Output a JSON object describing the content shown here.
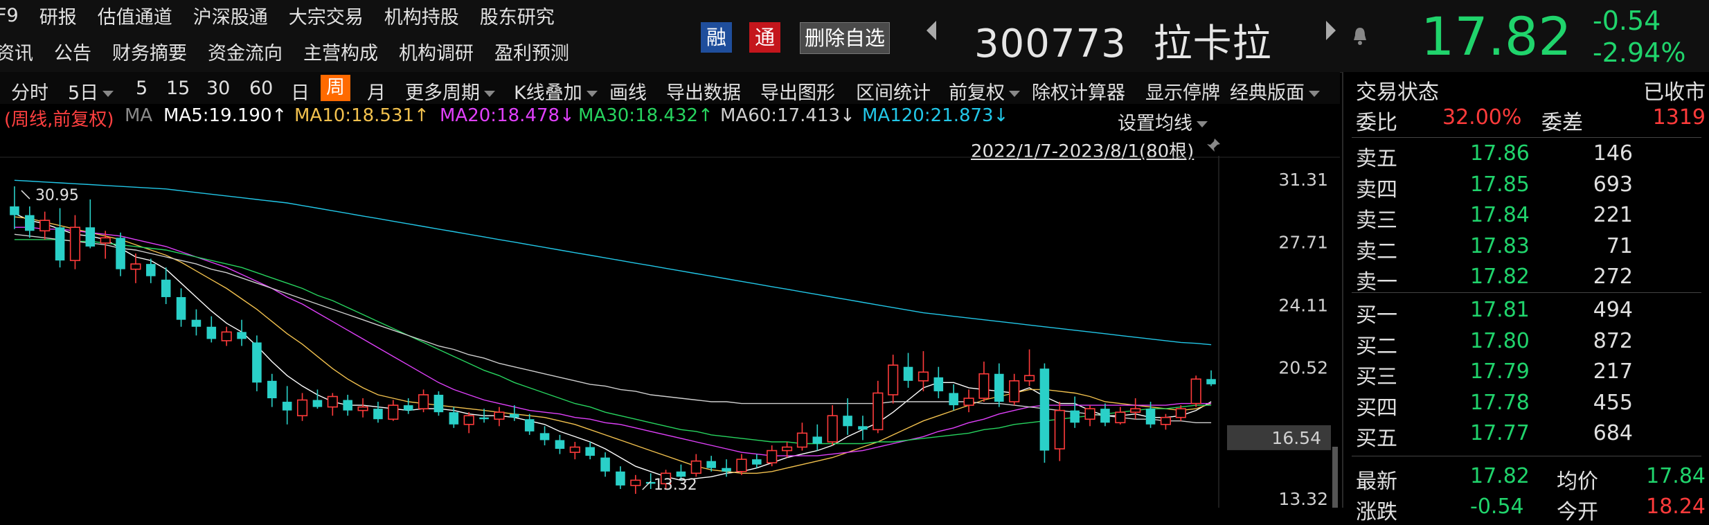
{
  "header": {
    "nav_row1": [
      "F9",
      "研报",
      "估值通道",
      "沪深股通",
      "大宗交易",
      "机构持股",
      "股东研究"
    ],
    "nav_row2": [
      "资讯",
      "公告",
      "财务摘要",
      "资金流向",
      "主营构成",
      "机构调研",
      "盈利预测"
    ],
    "badge_rong": "融",
    "badge_tong": "通",
    "remove_watch": "删除自选",
    "stock_code": "300773",
    "stock_name": "拉卡拉",
    "price": "17.82",
    "change": "-0.54",
    "change_pct": "-2.94%",
    "colors": {
      "up": "#ff3b3b",
      "down": "#20d46c",
      "badge_rong": "#1f4e9c",
      "badge_tong": "#c4161c"
    }
  },
  "toolbar": {
    "items": [
      "分时",
      "5日",
      "5",
      "15",
      "30",
      "60",
      "日",
      "周",
      "月",
      "更多周期",
      "K线叠加",
      "画线",
      "导出数据",
      "导出图形",
      "区间统计",
      "前复权",
      "除权计算器",
      "显示停牌",
      "经典版面"
    ],
    "active": "周"
  },
  "ma_legend": {
    "prefix": "(周线,前复权)",
    "ma_label": "MA",
    "items": [
      {
        "text": "MA5:19.190↑",
        "color": "#ffffff"
      },
      {
        "text": "MA10:18.531↑",
        "color": "#f2c14e"
      },
      {
        "text": "MA20:18.478↓",
        "color": "#e040fb"
      },
      {
        "text": "MA30:18.432↑",
        "color": "#27d45f"
      },
      {
        "text": "MA60:17.413↓",
        "color": "#cfcfcf"
      },
      {
        "text": "MA120:21.873↓",
        "color": "#22c7e8"
      }
    ],
    "setting": "设置均线",
    "range": "2022/1/7-2023/8/1(80根)"
  },
  "chart_data": {
    "type": "candlestick",
    "bar_count": 80,
    "y_ticks": [
      "31.31",
      "27.71",
      "24.11",
      "20.52",
      "16.54",
      "13.32"
    ],
    "ylim": [
      13.32,
      31.31
    ],
    "current_price_marker": "16.54",
    "annotations": {
      "high": "30.95",
      "low": "13.32"
    },
    "ohlc": [
      [
        29.8,
        30.95,
        28.5,
        29.3
      ],
      [
        29.3,
        29.8,
        28.0,
        28.4
      ],
      [
        28.4,
        29.5,
        27.9,
        29.0
      ],
      [
        28.6,
        29.7,
        26.3,
        26.7
      ],
      [
        26.7,
        29.3,
        26.2,
        28.6
      ],
      [
        28.6,
        30.2,
        27.4,
        27.5
      ],
      [
        27.7,
        28.4,
        26.8,
        28.0
      ],
      [
        28.0,
        28.3,
        25.8,
        26.2
      ],
      [
        26.2,
        27.1,
        25.4,
        26.5
      ],
      [
        26.5,
        26.8,
        25.4,
        25.8
      ],
      [
        25.6,
        26.3,
        24.2,
        24.6
      ],
      [
        24.6,
        25.1,
        22.9,
        23.3
      ],
      [
        23.3,
        23.9,
        22.4,
        22.9
      ],
      [
        22.9,
        23.5,
        22.0,
        22.2
      ],
      [
        22.1,
        22.9,
        21.8,
        22.6
      ],
      [
        22.6,
        23.3,
        21.8,
        22.2
      ],
      [
        22.0,
        22.4,
        19.2,
        19.7
      ],
      [
        19.8,
        20.2,
        18.3,
        18.8
      ],
      [
        18.6,
        19.5,
        17.3,
        18.1
      ],
      [
        17.8,
        19.1,
        17.5,
        18.7
      ],
      [
        18.7,
        19.3,
        18.2,
        18.3
      ],
      [
        18.3,
        19.1,
        17.8,
        18.9
      ],
      [
        18.7,
        19.0,
        17.8,
        18.1
      ],
      [
        18.1,
        18.8,
        17.7,
        18.3
      ],
      [
        18.2,
        18.6,
        17.4,
        17.6
      ],
      [
        17.6,
        18.7,
        17.5,
        18.4
      ],
      [
        18.4,
        18.8,
        17.9,
        18.1
      ],
      [
        18.2,
        19.3,
        18.0,
        19.0
      ],
      [
        19.0,
        19.2,
        17.8,
        18.0
      ],
      [
        18.0,
        18.3,
        17.1,
        17.3
      ],
      [
        17.3,
        18.0,
        16.8,
        17.8
      ],
      [
        17.7,
        18.2,
        17.4,
        17.6
      ],
      [
        17.6,
        18.3,
        17.2,
        18.0
      ],
      [
        17.9,
        18.4,
        17.5,
        17.7
      ],
      [
        17.6,
        17.9,
        16.7,
        16.9
      ],
      [
        16.8,
        17.2,
        16.1,
        16.4
      ],
      [
        16.4,
        16.7,
        15.6,
        15.9
      ],
      [
        15.7,
        16.3,
        15.3,
        16.0
      ],
      [
        16.0,
        16.3,
        15.3,
        15.5
      ],
      [
        15.4,
        15.7,
        14.3,
        14.6
      ],
      [
        14.6,
        14.9,
        13.6,
        13.8
      ],
      [
        13.8,
        14.4,
        13.32,
        14.1
      ],
      [
        14.0,
        14.5,
        13.6,
        13.9
      ],
      [
        13.9,
        14.7,
        13.6,
        14.5
      ],
      [
        14.6,
        15.0,
        14.1,
        14.3
      ],
      [
        14.5,
        15.6,
        14.3,
        15.2
      ],
      [
        15.2,
        15.5,
        14.6,
        14.8
      ],
      [
        14.8,
        15.3,
        14.3,
        14.6
      ],
      [
        14.6,
        15.6,
        14.4,
        15.3
      ],
      [
        15.3,
        15.6,
        14.8,
        15.0
      ],
      [
        15.1,
        16.1,
        14.9,
        15.8
      ],
      [
        15.8,
        16.3,
        15.4,
        16.0
      ],
      [
        16.0,
        17.4,
        15.8,
        16.8
      ],
      [
        16.6,
        17.3,
        15.8,
        16.2
      ],
      [
        16.3,
        18.4,
        16.1,
        17.8
      ],
      [
        17.8,
        18.8,
        16.7,
        17.2
      ],
      [
        17.2,
        17.8,
        16.4,
        17.0
      ],
      [
        17.0,
        19.8,
        16.8,
        19.1
      ],
      [
        19.0,
        21.3,
        18.5,
        20.7
      ],
      [
        20.6,
        21.4,
        19.4,
        19.8
      ],
      [
        19.8,
        21.5,
        19.2,
        20.3
      ],
      [
        20.0,
        20.6,
        18.8,
        19.2
      ],
      [
        19.1,
        19.6,
        18.1,
        18.4
      ],
      [
        18.4,
        19.3,
        18.0,
        18.8
      ],
      [
        18.8,
        20.9,
        18.6,
        20.2
      ],
      [
        20.2,
        20.8,
        18.3,
        18.6
      ],
      [
        18.6,
        20.2,
        18.4,
        19.8
      ],
      [
        19.8,
        21.6,
        19.5,
        20.1
      ],
      [
        20.5,
        20.8,
        15.1,
        15.8
      ],
      [
        15.9,
        18.6,
        15.2,
        18.1
      ],
      [
        18.1,
        18.9,
        17.1,
        17.4
      ],
      [
        17.6,
        18.4,
        17.2,
        18.2
      ],
      [
        18.2,
        18.5,
        17.2,
        17.4
      ],
      [
        17.4,
        18.3,
        17.3,
        18.0
      ],
      [
        18.0,
        18.8,
        17.6,
        18.2
      ],
      [
        18.2,
        18.6,
        17.1,
        17.3
      ],
      [
        17.3,
        17.9,
        17.0,
        17.7
      ],
      [
        17.7,
        18.4,
        17.5,
        18.2
      ],
      [
        18.5,
        20.1,
        18.3,
        19.9
      ],
      [
        19.9,
        20.4,
        19.5,
        19.6
      ]
    ],
    "ma5": [
      29.4,
      29.0,
      28.8,
      28.5,
      28.2,
      28.1,
      27.9,
      27.4,
      26.9,
      26.7,
      26.2,
      25.4,
      24.6,
      23.8,
      23.1,
      22.6,
      21.8,
      20.9,
      20.1,
      19.5,
      19.0,
      18.6,
      18.4,
      18.4,
      18.3,
      18.2,
      18.1,
      18.2,
      18.2,
      18.1,
      17.9,
      17.8,
      17.8,
      17.7,
      17.5,
      17.3,
      16.9,
      16.6,
      16.3,
      15.9,
      15.4,
      14.9,
      14.6,
      14.3,
      14.1,
      14.2,
      14.3,
      14.5,
      14.6,
      14.8,
      15.1,
      15.4,
      15.6,
      15.8,
      16.1,
      16.6,
      17.0,
      17.4,
      18.0,
      18.7,
      19.4,
      19.7,
      19.7,
      19.4,
      19.3,
      19.2,
      19.1,
      19.4,
      18.9,
      18.5,
      18.5,
      18.1,
      17.8,
      17.8,
      17.9,
      17.7,
      17.7,
      17.8,
      18.1,
      18.6
    ],
    "ma10": [
      29.2,
      29.1,
      28.9,
      28.7,
      28.5,
      28.3,
      28.1,
      27.9,
      27.6,
      27.3,
      27.0,
      26.6,
      26.1,
      25.6,
      25.1,
      24.5,
      23.9,
      23.2,
      22.5,
      21.9,
      21.2,
      20.5,
      19.9,
      19.4,
      19.0,
      18.8,
      18.6,
      18.5,
      18.4,
      18.3,
      18.2,
      18.1,
      18.0,
      17.9,
      17.8,
      17.7,
      17.5,
      17.3,
      17.0,
      16.7,
      16.4,
      16.1,
      15.8,
      15.5,
      15.2,
      14.9,
      14.7,
      14.6,
      14.5,
      14.5,
      14.6,
      14.8,
      15.0,
      15.2,
      15.4,
      15.7,
      16.0,
      16.3,
      16.7,
      17.1,
      17.5,
      17.8,
      18.1,
      18.4,
      18.7,
      18.9,
      19.1,
      19.3,
      19.3,
      19.2,
      19.1,
      18.9,
      18.6,
      18.5,
      18.4,
      18.3,
      18.2,
      18.1,
      18.2,
      18.5
    ],
    "ma20": [
      28.6,
      28.6,
      28.5,
      28.5,
      28.4,
      28.3,
      28.2,
      28.1,
      27.9,
      27.7,
      27.5,
      27.2,
      26.9,
      26.6,
      26.3,
      25.9,
      25.5,
      25.1,
      24.6,
      24.2,
      23.7,
      23.2,
      22.7,
      22.2,
      21.7,
      21.2,
      20.7,
      20.2,
      19.7,
      19.3,
      19.0,
      18.7,
      18.5,
      18.3,
      18.1,
      18.0,
      17.9,
      17.7,
      17.6,
      17.4,
      17.3,
      17.1,
      16.9,
      16.7,
      16.5,
      16.3,
      16.1,
      15.9,
      15.7,
      15.6,
      15.5,
      15.5,
      15.5,
      15.5,
      15.6,
      15.7,
      15.8,
      16.0,
      16.2,
      16.4,
      16.6,
      16.9,
      17.1,
      17.4,
      17.6,
      17.9,
      18.1,
      18.3,
      18.4,
      18.4,
      18.4,
      18.4,
      18.4,
      18.4,
      18.4,
      18.4,
      18.4,
      18.5,
      18.5,
      18.5
    ],
    "ma30": [
      27.9,
      27.9,
      27.9,
      27.9,
      27.8,
      27.8,
      27.7,
      27.6,
      27.5,
      27.4,
      27.3,
      27.1,
      26.9,
      26.7,
      26.5,
      26.3,
      26.0,
      25.7,
      25.4,
      25.1,
      24.7,
      24.4,
      24.0,
      23.6,
      23.2,
      22.8,
      22.4,
      22.0,
      21.6,
      21.2,
      20.8,
      20.4,
      20.1,
      19.7,
      19.4,
      19.1,
      18.8,
      18.5,
      18.3,
      18.0,
      17.8,
      17.6,
      17.4,
      17.2,
      17.0,
      16.9,
      16.7,
      16.6,
      16.5,
      16.4,
      16.3,
      16.3,
      16.2,
      16.2,
      16.2,
      16.2,
      16.2,
      16.3,
      16.3,
      16.4,
      16.5,
      16.6,
      16.7,
      16.8,
      17.0,
      17.1,
      17.3,
      17.4,
      17.5,
      17.6,
      17.7,
      17.8,
      17.9,
      18.0,
      18.1,
      18.2,
      18.2,
      18.3,
      18.4,
      18.4
    ],
    "ma60": [
      28.2,
      28.1,
      28.0,
      27.9,
      27.8,
      27.7,
      27.6,
      27.4,
      27.3,
      27.1,
      26.9,
      26.7,
      26.5,
      26.2,
      26.0,
      25.7,
      25.4,
      25.1,
      24.8,
      24.5,
      24.2,
      23.9,
      23.6,
      23.3,
      23.0,
      22.7,
      22.4,
      22.1,
      21.8,
      21.6,
      21.3,
      21.1,
      20.8,
      20.6,
      20.4,
      20.2,
      20.0,
      19.8,
      19.6,
      19.5,
      19.3,
      19.2,
      19.0,
      18.9,
      18.8,
      18.7,
      18.6,
      18.6,
      18.5,
      18.5,
      18.5,
      18.5,
      18.5,
      18.5,
      18.5,
      18.5,
      18.5,
      18.5,
      18.6,
      18.6,
      18.6,
      18.6,
      18.6,
      18.6,
      18.5,
      18.5,
      18.4,
      18.3,
      18.2,
      18.1,
      18.0,
      17.9,
      17.8,
      17.7,
      17.6,
      17.6,
      17.5,
      17.5,
      17.4,
      17.4
    ],
    "ma120": [
      31.3,
      31.25,
      31.2,
      31.15,
      31.1,
      31.05,
      31.0,
      30.95,
      30.9,
      30.85,
      30.8,
      30.7,
      30.6,
      30.5,
      30.4,
      30.3,
      30.2,
      30.1,
      30.0,
      29.85,
      29.7,
      29.55,
      29.4,
      29.25,
      29.1,
      28.95,
      28.8,
      28.65,
      28.5,
      28.35,
      28.2,
      28.05,
      27.9,
      27.75,
      27.6,
      27.45,
      27.3,
      27.15,
      27.0,
      26.85,
      26.7,
      26.55,
      26.4,
      26.25,
      26.1,
      25.95,
      25.8,
      25.65,
      25.5,
      25.35,
      25.2,
      25.05,
      24.9,
      24.75,
      24.6,
      24.45,
      24.3,
      24.15,
      24.0,
      23.85,
      23.7,
      23.6,
      23.5,
      23.4,
      23.3,
      23.2,
      23.1,
      23.0,
      22.9,
      22.8,
      22.7,
      22.6,
      22.5,
      22.4,
      22.3,
      22.2,
      22.1,
      22.0,
      21.95,
      21.87
    ]
  },
  "panel": {
    "trade_status_label": "交易状态",
    "trade_status_value": "已收市",
    "weibi_label": "委比",
    "weibi_value": "32.00%",
    "weicha_label": "委差",
    "weicha_value": "1319",
    "asks": [
      {
        "label": "卖五",
        "price": "17.86",
        "vol": "146"
      },
      {
        "label": "卖四",
        "price": "17.85",
        "vol": "693"
      },
      {
        "label": "卖三",
        "price": "17.84",
        "vol": "221"
      },
      {
        "label": "卖二",
        "price": "17.83",
        "vol": "71"
      },
      {
        "label": "卖一",
        "price": "17.82",
        "vol": "272"
      }
    ],
    "bids": [
      {
        "label": "买一",
        "price": "17.81",
        "vol": "494"
      },
      {
        "label": "买二",
        "price": "17.80",
        "vol": "872"
      },
      {
        "label": "买三",
        "price": "17.79",
        "vol": "217"
      },
      {
        "label": "买四",
        "price": "17.78",
        "vol": "455"
      },
      {
        "label": "买五",
        "price": "17.77",
        "vol": "684"
      }
    ],
    "latest_label": "最新",
    "latest_value": "17.82",
    "avg_label": "均价",
    "avg_value": "17.84",
    "zhangdie_label": "涨跌",
    "zhangdie_value": "-0.54",
    "jinkai_label": "今开",
    "jinkai_value": "18.24"
  }
}
